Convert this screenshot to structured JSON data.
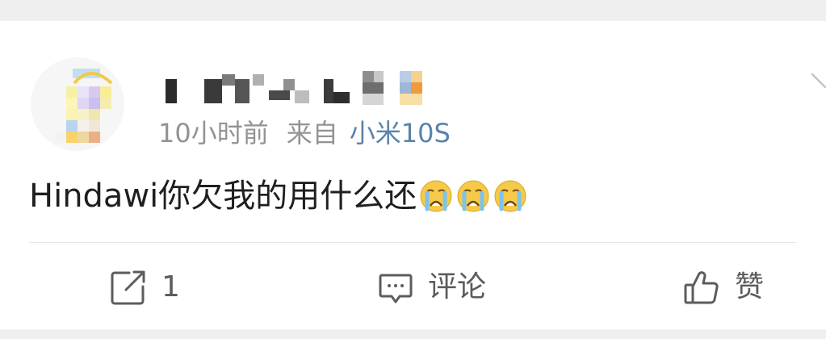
{
  "post": {
    "time": "10小时前",
    "source_label": "来自",
    "device": "小米10S",
    "text": "Hindawi你欠我的用什么还",
    "emojis": [
      "crying-face",
      "crying-face",
      "crying-face"
    ]
  },
  "actions": {
    "repost_count": "1",
    "comment_label": "评论",
    "like_label": "赞"
  },
  "colors": {
    "background": "#efefef",
    "card": "#ffffff",
    "meta_text": "#939393",
    "device_link": "#5a83ab",
    "action_text": "#5c5c5c"
  }
}
